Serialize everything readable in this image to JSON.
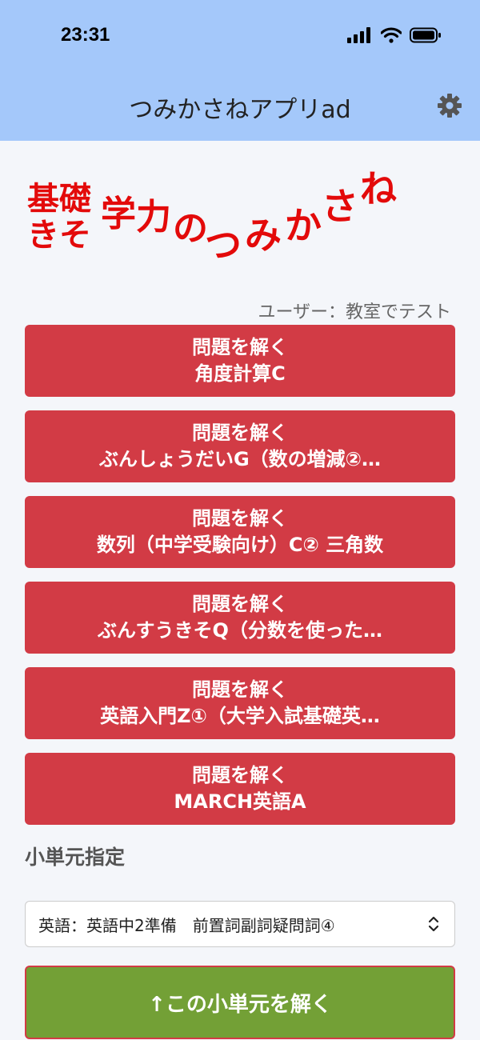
{
  "status_bar": {
    "time": "23:31"
  },
  "header": {
    "title": "つみかさねアプリad"
  },
  "logo": {
    "line1a": "基礎",
    "line1b": "きそ",
    "chars": [
      "学",
      "力",
      "の",
      "つ",
      "み",
      "か",
      "さ",
      "ね"
    ]
  },
  "user": {
    "label": "ユーザー：教室でテスト"
  },
  "solve_buttons": [
    {
      "action": "問題を解く",
      "unit": "角度計算C"
    },
    {
      "action": "問題を解く",
      "unit": "ぶんしょうだいG（数の増減②…"
    },
    {
      "action": "問題を解く",
      "unit": "数列（中学受験向け）C② 三角数"
    },
    {
      "action": "問題を解く",
      "unit": "ぶんすうきそQ（分数を使った…"
    },
    {
      "action": "問題を解く",
      "unit": "英語入門Z①（大学入試基礎英…"
    },
    {
      "action": "問題を解く",
      "unit": "MARCH英語A"
    }
  ],
  "sub_unit": {
    "heading": "小単元指定",
    "selected": "英語：英語中2準備　前置詞副詞疑問詞④",
    "submit_label": "↑この小単元を解く"
  },
  "colors": {
    "header_bg": "#a4c8fa",
    "button_red": "#d23b45",
    "button_green": "#73a036",
    "logo_red": "#e30a0a"
  }
}
